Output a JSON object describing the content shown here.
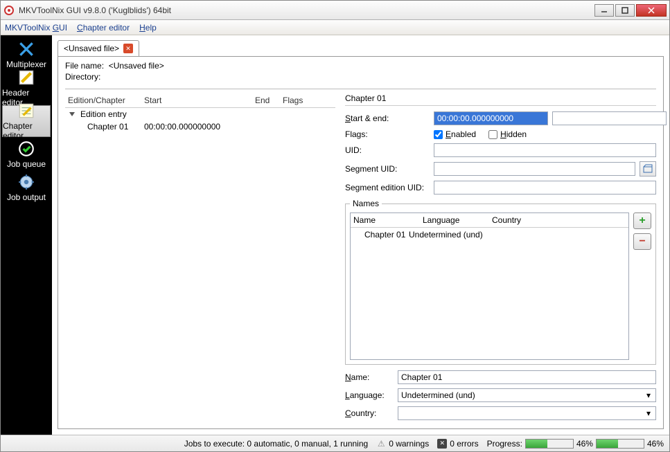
{
  "window": {
    "title": "MKVToolNix GUI v9.8.0 ('Kuglblids') 64bit"
  },
  "menu": {
    "gui": "MKVToolNix GUI",
    "chapter": "Chapter editor",
    "help": "Help"
  },
  "sidebar": {
    "items": [
      {
        "label": "Multiplexer"
      },
      {
        "label": "Header editor"
      },
      {
        "label": "Chapter editor"
      },
      {
        "label": "Job queue"
      },
      {
        "label": "Job output"
      }
    ]
  },
  "tab": {
    "label": "<Unsaved file>"
  },
  "fileinfo": {
    "name_label": "File name:",
    "name_value": "<Unsaved file>",
    "dir_label": "Directory:"
  },
  "tree": {
    "cols": {
      "edition": "Edition/Chapter",
      "start": "Start",
      "end": "End",
      "flags": "Flags"
    },
    "root": "Edition entry",
    "child": {
      "label": "Chapter 01",
      "start": "00:00:00.000000000"
    }
  },
  "details": {
    "title": "Chapter 01",
    "labels": {
      "start_end": "Start & end:",
      "flags": "Flags:",
      "enabled": "Enabled",
      "hidden": "Hidden",
      "uid": "UID:",
      "segment_uid": "Segment UID:",
      "segment_edition_uid": "Segment edition UID:",
      "names": "Names",
      "name": "Name",
      "language": "Language",
      "country": "Country",
      "name_lbl": "Name:",
      "language_lbl": "Language:",
      "country_lbl": "Country:"
    },
    "start_value": "00:00:00.000000000",
    "end_value": "",
    "enabled": true,
    "hidden": false,
    "uid": "",
    "segment_uid": "",
    "segment_edition_uid": "",
    "names_row": {
      "name": "Chapter 01",
      "language": "Undetermined (und)",
      "country": ""
    },
    "name_field": "Chapter 01",
    "language_field": "Undetermined (und)",
    "country_field": ""
  },
  "status": {
    "jobs": "Jobs to execute:  0 automatic, 0 manual, 1 running",
    "warnings": "0 warnings",
    "errors": "0 errors",
    "progress_label": "Progress:",
    "progress1": 46,
    "progress2": 46,
    "progress1_text": "46%",
    "progress2_text": "46%"
  }
}
